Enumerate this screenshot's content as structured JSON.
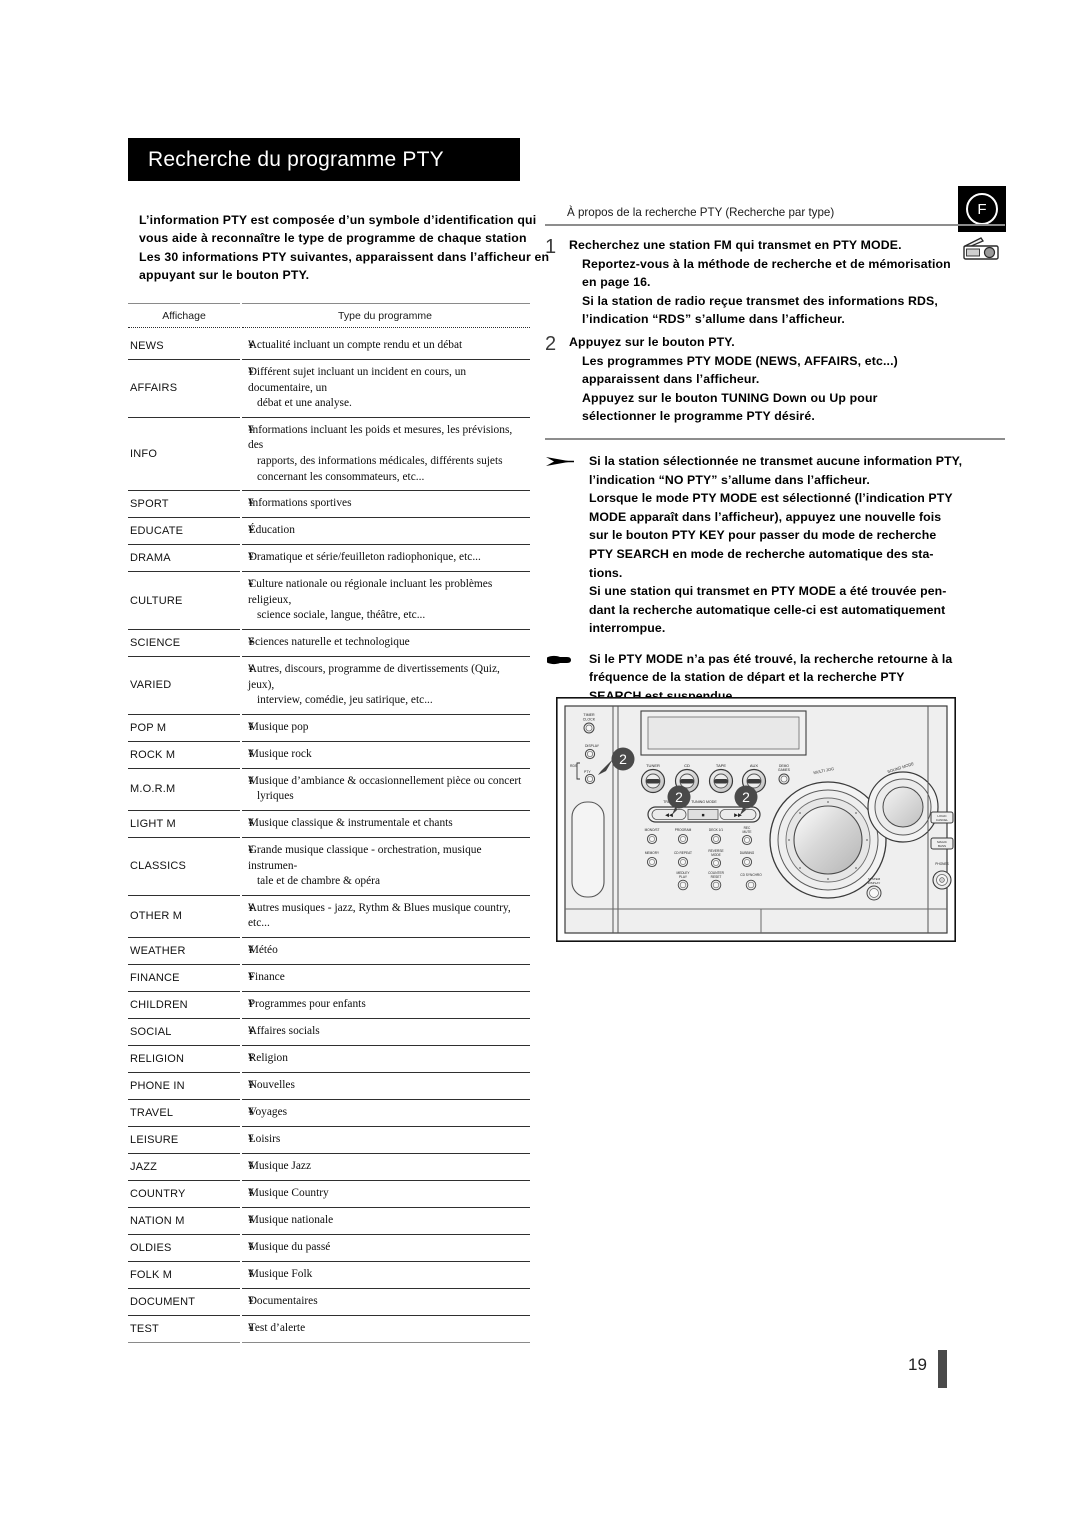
{
  "document": {
    "language": "fr",
    "page_number": "19",
    "region_badge": "F"
  },
  "header": {
    "title": "Recherche du programme PTY"
  },
  "intro": {
    "lines": [
      "L’information PTY est composée d’un symbole d’identification qui",
      "vous aide à reconnaître le type de programme de chaque station",
      "Les 30 informations PTY suivantes, apparaissent dans l’afficheur en",
      "appuyant sur le bouton PTY."
    ],
    "overlap_fm": "FM"
  },
  "table": {
    "headers": {
      "display": "Affichage",
      "program_type": "Type du programme"
    },
    "rows": [
      {
        "code": "NEWS",
        "lines": [
          "Actualité incluant un compte rendu et un débat"
        ]
      },
      {
        "code": "AFFAIRS",
        "lines": [
          "Différent sujet incluant un incident en cours, un documentaire, un",
          "débat et une analyse."
        ]
      },
      {
        "code": "INFO",
        "lines": [
          "Informations incluant les poids et mesures, les prévisions, des",
          "rapports, des informations médicales, différents sujets",
          "concernant les consommateurs, etc..."
        ]
      },
      {
        "code": "SPORT",
        "lines": [
          "Informations sportives"
        ]
      },
      {
        "code": "EDUCATE",
        "lines": [
          "Éducation"
        ]
      },
      {
        "code": "DRAMA",
        "lines": [
          "Dramatique et série/feuilleton radiophonique, etc..."
        ]
      },
      {
        "code": "CULTURE",
        "lines": [
          "Culture nationale ou régionale incluant les problèmes religieux,",
          "science sociale, langue, théâtre, etc..."
        ]
      },
      {
        "code": "SCIENCE",
        "lines": [
          "Sciences naturelle et technologique"
        ]
      },
      {
        "code": "VARIED",
        "lines": [
          "Autres, discours, programme de divertissements (Quiz, jeux),",
          "interview, comédie, jeu satirique, etc..."
        ]
      },
      {
        "code": "POP M",
        "lines": [
          "Musique pop"
        ]
      },
      {
        "code": "ROCK M",
        "lines": [
          "Musique rock"
        ]
      },
      {
        "code": "M.O.R.M",
        "lines": [
          "Musique d’ambiance & occasionnellement pièce ou concert",
          "lyriques"
        ]
      },
      {
        "code": "LIGHT M",
        "lines": [
          "Musique classique & instrumentale et chants"
        ]
      },
      {
        "code": "CLASSICS",
        "lines": [
          "Grande musique classique - orchestration, musique instrumen-",
          "tale et de chambre & opéra"
        ]
      },
      {
        "code": "OTHER M",
        "lines": [
          "Autres musiques - jazz, Rythm & Blues musique country, etc..."
        ]
      },
      {
        "code": "WEATHER",
        "lines": [
          "Météo"
        ]
      },
      {
        "code": "FINANCE",
        "lines": [
          "Finance"
        ]
      },
      {
        "code": "CHILDREN",
        "lines": [
          "Programmes pour enfants"
        ]
      },
      {
        "code": "SOCIAL",
        "lines": [
          "Affaires socials"
        ]
      },
      {
        "code": "RELIGION",
        "lines": [
          "Religion"
        ]
      },
      {
        "code": "PHONE IN",
        "lines": [
          "Nouvelles"
        ]
      },
      {
        "code": "TRAVEL",
        "lines": [
          "Voyages"
        ]
      },
      {
        "code": "LEISURE",
        "lines": [
          "Loisirs"
        ]
      },
      {
        "code": "JAZZ",
        "lines": [
          "Musique Jazz"
        ]
      },
      {
        "code": "COUNTRY",
        "lines": [
          "Musique Country"
        ]
      },
      {
        "code": "NATION M",
        "lines": [
          "Musique nationale"
        ]
      },
      {
        "code": "OLDIES",
        "lines": [
          "Musique du passé"
        ]
      },
      {
        "code": "FOLK M",
        "lines": [
          "Musique Folk"
        ]
      },
      {
        "code": "DOCUMENT",
        "lines": [
          "Documentaires"
        ]
      },
      {
        "code": "TEST",
        "lines": [
          "Test d’alerte"
        ]
      }
    ]
  },
  "right_column": {
    "about_line": "À propos de la recherche  PTY  (Recherche par type)",
    "steps": [
      {
        "number": "1",
        "lines": [
          "Recherchez une station FM qui transmet en PTY MODE.",
          "Reportez-vous à la méthode de recherche et de mémorisation",
          "en page 16.",
          "Si la station de radio reçue transmet des informations RDS,",
          "l’indication “RDS” s’allume dans l’afficheur."
        ]
      },
      {
        "number": "2",
        "lines": [
          "Appuyez sur le bouton PTY.",
          "Les programmes PTY MODE (NEWS, AFFAIRS, etc...)",
          "apparaissent dans l’afficheur.",
          "Appuyez sur le bouton TUNING Down ou Up pour",
          "sélectionner le programme PTY désiré."
        ]
      }
    ],
    "notes": [
      {
        "icon": "arrow-note-icon",
        "lines": [
          "Si la station sélectionnée ne transmet aucune information PTY,",
          "l’indication “NO PTY” s’allume dans l’afficheur.",
          "Lorsque le mode PTY MODE est sélectionné (l’indication PTY",
          "MODE apparaît dans l’afficheur), appuyez une nouvelle fois",
          "sur le bouton PTY KEY pour passer du mode de recherche",
          "PTY SEARCH en mode de recherche automatique des sta-",
          "tions.",
          "Si une station qui transmet en PTY MODE a été trouvée pen-",
          "dant la recherche automatique celle-ci est automatiquement",
          "interrompue."
        ]
      },
      {
        "icon": "hand-pointer-icon",
        "lines": [
          "Si le PTY MODE n’a pas été trouvé, la recherche retourne à la",
          "fréquence de la station de départ et la recherche PTY",
          "SEARCH est suspendue."
        ]
      }
    ]
  },
  "device_illustration": {
    "callouts": [
      "2",
      "2",
      "2"
    ],
    "labels": {
      "timer_clock": "TIMER CLOCK",
      "display": "DISPLAY",
      "rds": "RDS",
      "pty": "PTY",
      "tuner": "TUNER",
      "cd": "CD",
      "tape": "TAPE",
      "aux": "AUX",
      "demo": "DEMO",
      "tuning_mode": "TUNING MODE",
      "track_left": "TRACK",
      "track_right": "TRACK",
      "multi_jog": "MULTI JOG",
      "sound_mode": "SOUND MODE",
      "mono_st": "MONO/ST",
      "program": "PROGRAM",
      "deck": "DECK 1/1",
      "rec_mute": "REC MUTE",
      "memory": "MEMORY",
      "cd_repeat": "CD REPEAT",
      "reverse_mode": "REVERSE MODE",
      "dubbing": "DUBBING",
      "medley_play": "MEDLEY PLAY",
      "counter_reset": "COUNTER RESET",
      "cd_synchro": "CD SYNCHRO",
      "system_display": "SYSTEM DISPLAY",
      "logic_cancel": "LOGIC CANCEL",
      "magic_bass": "MAGIC BASS",
      "phones": "PHONES"
    }
  },
  "colors": {
    "header_bg": "#000000",
    "header_text": "#ffffff",
    "rule": "#8d8d8d",
    "row_rule": "#2f2f2f",
    "body_text": "#000000",
    "page_bar": "#4a4a4a"
  }
}
